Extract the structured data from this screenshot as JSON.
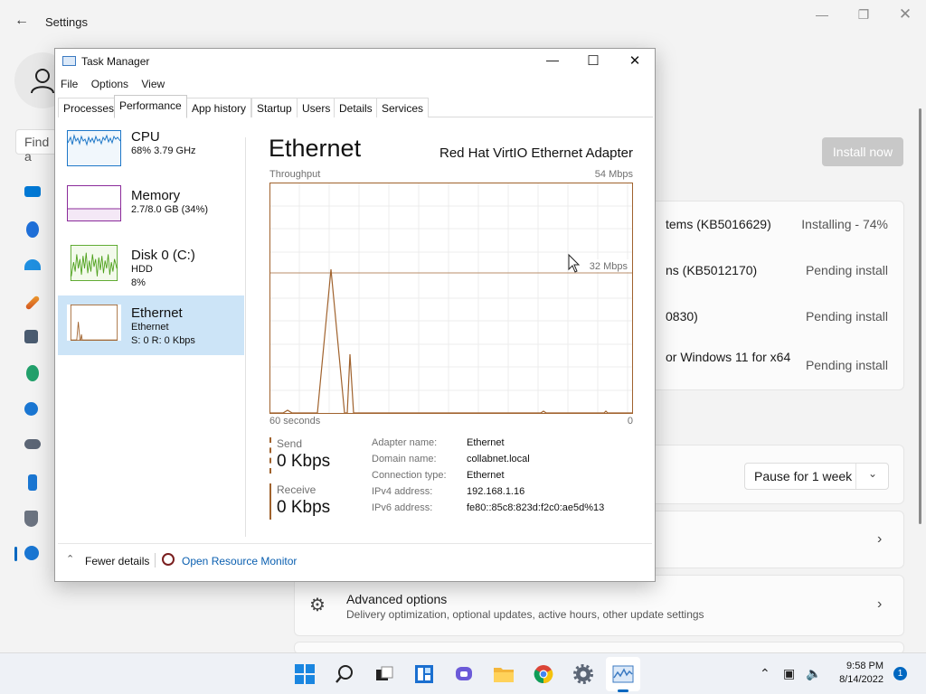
{
  "settings": {
    "title": "Settings",
    "search_placeholder": "Find a",
    "install_now": "Install now",
    "updates": [
      {
        "name": "tems (KB5016629)",
        "status": "Installing - 74%"
      },
      {
        "name": "ns (KB5012170)",
        "status": "Pending install"
      },
      {
        "name": "0830)",
        "status": "Pending install"
      },
      {
        "name": "or Windows 11 for x64",
        "status": "Pending install"
      }
    ],
    "pause_label": "Pause for 1 week",
    "advanced_title": "Advanced options",
    "advanced_sub": "Delivery optimization, optional updates, active hours, other update settings"
  },
  "task_manager": {
    "title": "Task Manager",
    "menu": [
      "File",
      "Options",
      "View"
    ],
    "tabs": [
      "Processes",
      "Performance",
      "App history",
      "Startup",
      "Users",
      "Details",
      "Services"
    ],
    "active_tab": "Performance",
    "items": [
      {
        "name": "CPU",
        "sub1": "68% 3.79 GHz",
        "sub2": ""
      },
      {
        "name": "Memory",
        "sub1": "2.7/8.0 GB (34%)",
        "sub2": ""
      },
      {
        "name": "Disk 0 (C:)",
        "sub1": "HDD",
        "sub2": "8%"
      },
      {
        "name": "Ethernet",
        "sub1": "Ethernet",
        "sub2": "S: 0 R: 0 Kbps"
      }
    ],
    "detail": {
      "title": "Ethernet",
      "adapter": "Red Hat VirtIO Ethernet Adapter",
      "throughput_label": "Throughput",
      "max_label": "54 Mbps",
      "mid_label": "32 Mbps",
      "time_left": "60 seconds",
      "time_right": "0",
      "send_label": "Send",
      "send_value": "0 Kbps",
      "receive_label": "Receive",
      "receive_value": "0 Kbps",
      "info": [
        {
          "k": "Adapter name:",
          "v": "Ethernet"
        },
        {
          "k": "Domain name:",
          "v": "collabnet.local"
        },
        {
          "k": "Connection type:",
          "v": "Ethernet"
        },
        {
          "k": "IPv4 address:",
          "v": "192.168.1.16"
        },
        {
          "k": "IPv6 address:",
          "v": "fe80::85c8:823d:f2c0:ae5d%13"
        }
      ]
    },
    "fewer_details": "Fewer details",
    "open_resource_monitor": "Open Resource Monitor"
  },
  "taskbar": {
    "time": "9:58 PM",
    "date": "8/14/2022",
    "notifications": "1"
  },
  "colors": {
    "accent": "#0067c0",
    "ethernet": "#a0622d",
    "cpu": "#1f78c8",
    "memory": "#8b2b9a",
    "disk": "#4ca01a"
  }
}
